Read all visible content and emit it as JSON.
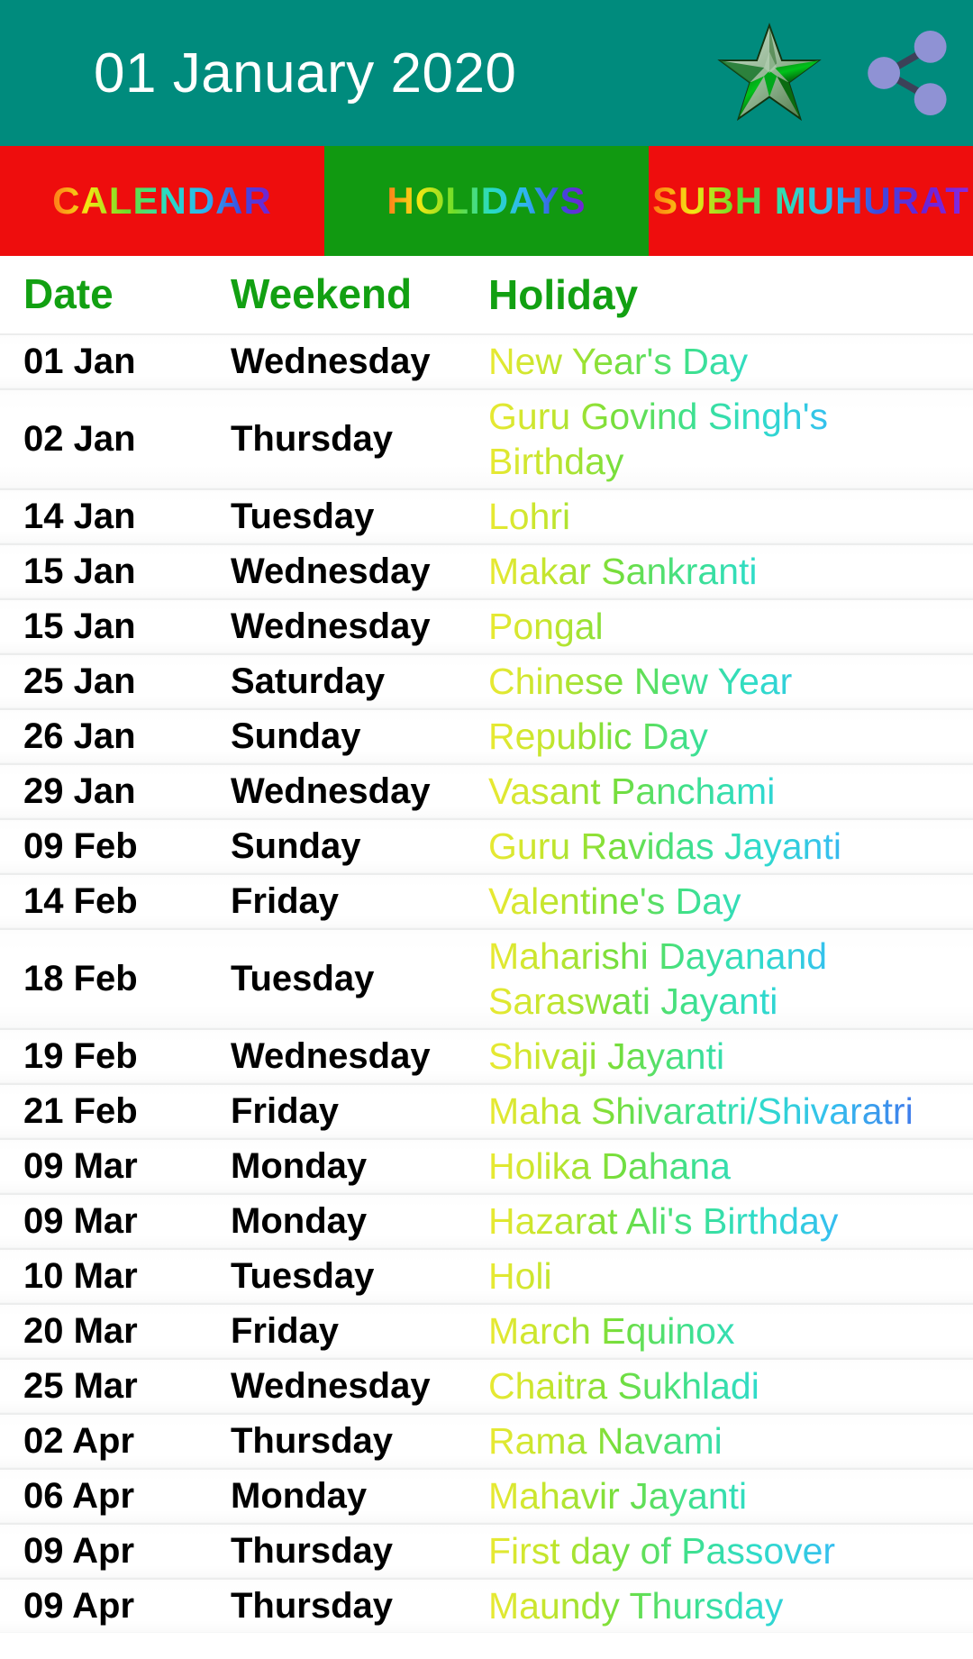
{
  "header": {
    "title": "01 January 2020",
    "background_color": "#008b7d",
    "title_color": "#ffffff",
    "icons": [
      {
        "name": "star-icon",
        "label": "Rate / Favorite"
      },
      {
        "name": "share-icon",
        "label": "Share"
      }
    ]
  },
  "tabs": [
    {
      "id": "calendar",
      "label": "CALENDAR",
      "background_color": "#ee0d0d",
      "selected": false
    },
    {
      "id": "holidays",
      "label": "HOLIDAYS",
      "background_color": "#119911",
      "selected": true
    },
    {
      "id": "subh-muhurat",
      "label": "SUBH MUHURAT",
      "background_color": "#ee0d0d",
      "selected": false
    }
  ],
  "table": {
    "header_color": "#12a012",
    "columns": [
      "Date",
      "Weekend",
      "Holiday"
    ],
    "rows": [
      {
        "date": "01 Jan",
        "weekend": "Wednesday",
        "holiday": "New Year's Day"
      },
      {
        "date": "02 Jan",
        "weekend": "Thursday",
        "holiday": "Guru Govind Singh's Birthday"
      },
      {
        "date": "14 Jan",
        "weekend": "Tuesday",
        "holiday": "Lohri"
      },
      {
        "date": "15 Jan",
        "weekend": "Wednesday",
        "holiday": "Makar Sankranti"
      },
      {
        "date": "15 Jan",
        "weekend": "Wednesday",
        "holiday": "Pongal"
      },
      {
        "date": "25 Jan",
        "weekend": "Saturday",
        "holiday": "Chinese New Year"
      },
      {
        "date": "26 Jan",
        "weekend": "Sunday",
        "holiday": "Republic Day"
      },
      {
        "date": "29 Jan",
        "weekend": "Wednesday",
        "holiday": "Vasant Panchami"
      },
      {
        "date": "09 Feb",
        "weekend": "Sunday",
        "holiday": "Guru Ravidas Jayanti"
      },
      {
        "date": "14 Feb",
        "weekend": "Friday",
        "holiday": "Valentine's Day"
      },
      {
        "date": "18 Feb",
        "weekend": "Tuesday",
        "holiday": "Maharishi Dayanand Saraswati Jayanti"
      },
      {
        "date": "19 Feb",
        "weekend": "Wednesday",
        "holiday": "Shivaji Jayanti"
      },
      {
        "date": "21 Feb",
        "weekend": "Friday",
        "holiday": "Maha Shivaratri/Shivaratri"
      },
      {
        "date": "09 Mar",
        "weekend": "Monday",
        "holiday": "Holika Dahana"
      },
      {
        "date": "09 Mar",
        "weekend": "Monday",
        "holiday": "Hazarat Ali's Birthday"
      },
      {
        "date": "10 Mar",
        "weekend": "Tuesday",
        "holiday": "Holi"
      },
      {
        "date": "20 Mar",
        "weekend": "Friday",
        "holiday": "March Equinox"
      },
      {
        "date": "25 Mar",
        "weekend": "Wednesday",
        "holiday": "Chaitra Sukhladi"
      },
      {
        "date": "02 Apr",
        "weekend": "Thursday",
        "holiday": "Rama Navami"
      },
      {
        "date": "06 Apr",
        "weekend": "Monday",
        "holiday": "Mahavir Jayanti"
      },
      {
        "date": "09 Apr",
        "weekend": "Thursday",
        "holiday": "First day of Passover"
      },
      {
        "date": "09 Apr",
        "weekend": "Thursday",
        "holiday": "Maundy Thursday"
      }
    ]
  }
}
